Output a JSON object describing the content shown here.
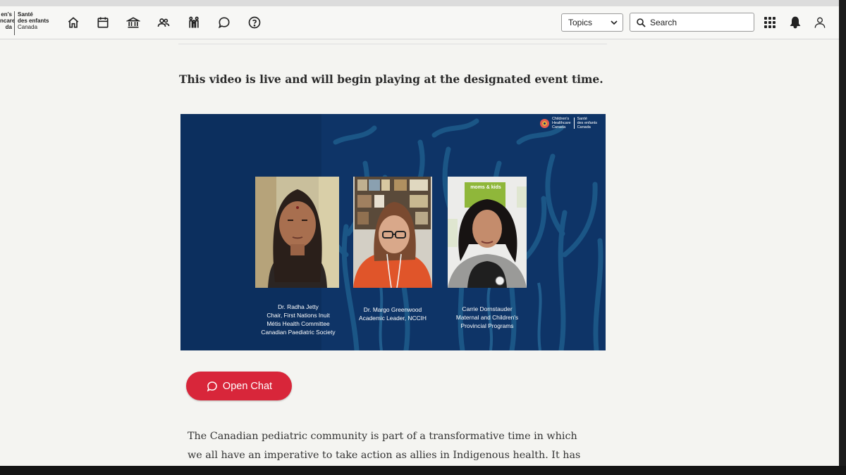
{
  "header": {
    "logo": {
      "en_line1": "en's",
      "en_line2": "ncare",
      "en_line3": "da",
      "fr_line1": "Santé",
      "fr_line2": "des enfants",
      "fr_line3": "Canada"
    },
    "nav_icons": [
      "home-icon",
      "calendar-icon",
      "library-icon",
      "people-icon",
      "family-icon",
      "chat-bubble-icon",
      "help-icon"
    ],
    "topics_label": "Topics",
    "search_placeholder": "Search",
    "right_icons": [
      "apps-grid-icon",
      "bell-icon",
      "user-icon"
    ]
  },
  "main": {
    "live_message": "This video is live and will begin playing at the designated event time.",
    "video": {
      "brand": {
        "en_line1": "Children's",
        "en_line2": "Healthcare",
        "en_line3": "Canada",
        "fr_line1": "Santé",
        "fr_line2": "des enfants",
        "fr_line3": "Canada"
      },
      "panelists": [
        {
          "name": "Dr. Radha Jetty",
          "role_lines": [
            "Chair, First Nations Inuit",
            "Métis Health Committee",
            "Canadian Paediatric Society"
          ]
        },
        {
          "name": "Dr. Margo Greenwood",
          "role_lines": [
            "Academic Leader, NCCIH"
          ]
        },
        {
          "name": "Carrie Dornstauder",
          "role_lines": [
            "Maternal and Children's",
            "Provincial Programs"
          ],
          "backdrop_text": "moms & kids"
        }
      ]
    },
    "open_chat_label": "Open Chat",
    "paragraph_line1": "The Canadian pediatric community is part of a transformative time in which",
    "paragraph_line2": "we all have an imperative to take action as allies in Indigenous health. It has"
  },
  "colors": {
    "accent_red": "#d8263a",
    "video_blue": "#0e3467",
    "page_bg": "#f4f4f1"
  }
}
